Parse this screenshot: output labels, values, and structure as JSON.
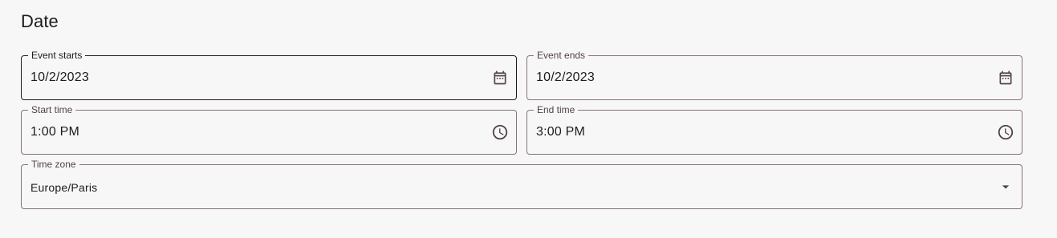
{
  "section": {
    "title": "Date"
  },
  "event_starts": {
    "label": "Event starts",
    "value": "10/2/2023",
    "icon": "calendar-icon"
  },
  "event_ends": {
    "label": "Event ends",
    "value": "10/2/2023",
    "icon": "calendar-icon"
  },
  "start_time": {
    "label": "Start time",
    "value": "1:00 PM",
    "icon": "clock-icon"
  },
  "end_time": {
    "label": "End time",
    "value": "3:00 PM",
    "icon": "clock-icon"
  },
  "time_zone": {
    "label": "Time zone",
    "value": "Europe/Paris",
    "icon": "dropdown-arrow-icon"
  },
  "colors": {
    "background": "#f8f7f7",
    "text": "#1e1b1b",
    "outline": "#857373",
    "label": "#524343",
    "icon": "#524343"
  }
}
